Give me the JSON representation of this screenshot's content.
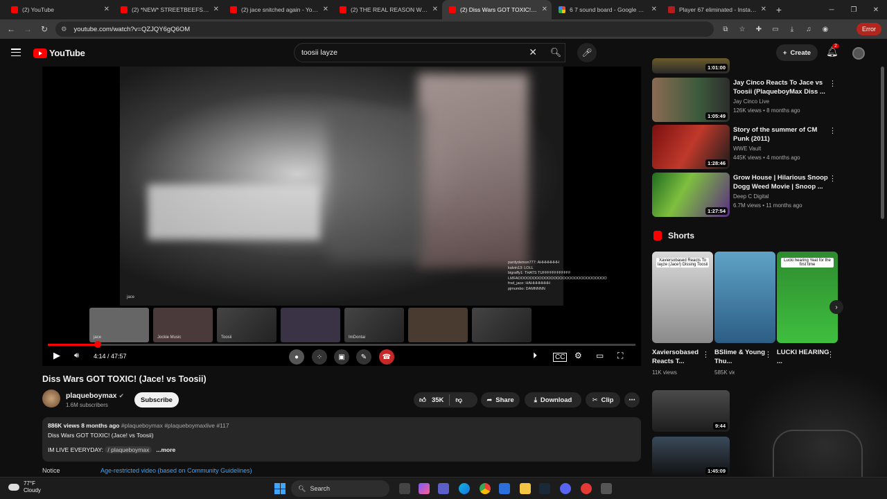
{
  "browser": {
    "tabs": [
      {
        "title": "(2) YouTube",
        "fav": "youtube"
      },
      {
        "title": "(2) *NEW* STREETBEEFS | Crazy",
        "fav": "youtube"
      },
      {
        "title": "(2) jace snitched again - YouTu",
        "fav": "youtube"
      },
      {
        "title": "(2) THE REAL REASON WHY IA",
        "fav": "youtube"
      },
      {
        "title": "(2) Diss Wars GOT TOXIC! (Jace",
        "fav": "youtube"
      },
      {
        "title": "6 7 sound board - Google Sear",
        "fav": "google"
      },
      {
        "title": "Player 67 eliminated - Instant S",
        "fav": "myinstants"
      }
    ],
    "url": "youtube.com/watch?v=QZJQY6gQ6OM",
    "error_label": "Error"
  },
  "header": {
    "logo_text": "YouTube",
    "search_value": "toosii layze",
    "create_label": "Create",
    "notification_count": "2"
  },
  "player": {
    "time": "4:14 / 47:57",
    "progress_fraction": 0.085,
    "cam_label": "jace",
    "strip": [
      "jace",
      "Jockie Music",
      "Toosii",
      "",
      "ImDontai",
      "",
      ""
    ],
    "chat": [
      "pardydemon777: AHHHHHHH",
      "kalvin13: LOLL",
      "bigraffy1: THATS TUFFFFFFFFFFFF",
      "LMFAOOOOOOOOOOOOOOOOOOOOOOOOOOOOOO",
      "frsd_jace: HAHHHHHHH",
      "pjmumbo: DAMNNNN"
    ]
  },
  "video": {
    "title": "Diss Wars GOT TOXIC! (Jace! vs Toosii)",
    "channel": "plaqueboymax",
    "subscribers": "1.6M subscribers",
    "subscribe_label": "Subscribe",
    "likes": "35K",
    "share_label": "Share",
    "download_label": "Download",
    "clip_label": "Clip",
    "desc_meta": "886K views  8 months ago",
    "desc_tags": "#plaqueboymax #plaqueboymaxlive #117",
    "desc_line": "Diss Wars GOT TOXIC! (Jace! vs Toosii)",
    "desc_tagline": "IM LIVE EVERYDAY:",
    "desc_link": "/ plaqueboymax",
    "more_label": "...more",
    "notice_label": "Notice",
    "notice_link": "Age-restricted video (based on Community Guidelines)"
  },
  "sidebar": {
    "top_partial_duration": "1:01:00",
    "recs": [
      {
        "title": "Jay Cinco Reacts To Jace vs Toosii (PlaqueboyMax Diss ...",
        "channel": "Jay Cinco Live",
        "views": "126K views • 8 months ago",
        "duration": "1:05:49"
      },
      {
        "title": "Story of the summer of CM Punk (2011)",
        "channel": "WWE Vault",
        "views": "445K views • 4 months ago",
        "duration": "1:28:46"
      },
      {
        "title": "Grow House | Hilarious Snoop Dogg Weed Movie | Snoop ...",
        "channel": "Deep C Digital",
        "views": "6.7M views • 11 months ago",
        "duration": "1:27:54"
      }
    ],
    "shorts_label": "Shorts",
    "shorts": [
      {
        "title": "Xaviersobased Reacts T...",
        "views": "11K views",
        "caption": "Xaviersobased Reacts To Iayze (Jace!) Dissing Toosii"
      },
      {
        "title": "BSlime & Young Thu...",
        "views": "585K views",
        "caption": ""
      },
      {
        "title": "LUCKI HEARING ...",
        "views": "",
        "caption": "Lucki hearing Yeat for the first time"
      }
    ],
    "bottom_durations": [
      "9:44",
      "1:45:09"
    ]
  },
  "taskbar": {
    "temp": "77°F",
    "condition": "Cloudy",
    "search_label": "Search"
  }
}
